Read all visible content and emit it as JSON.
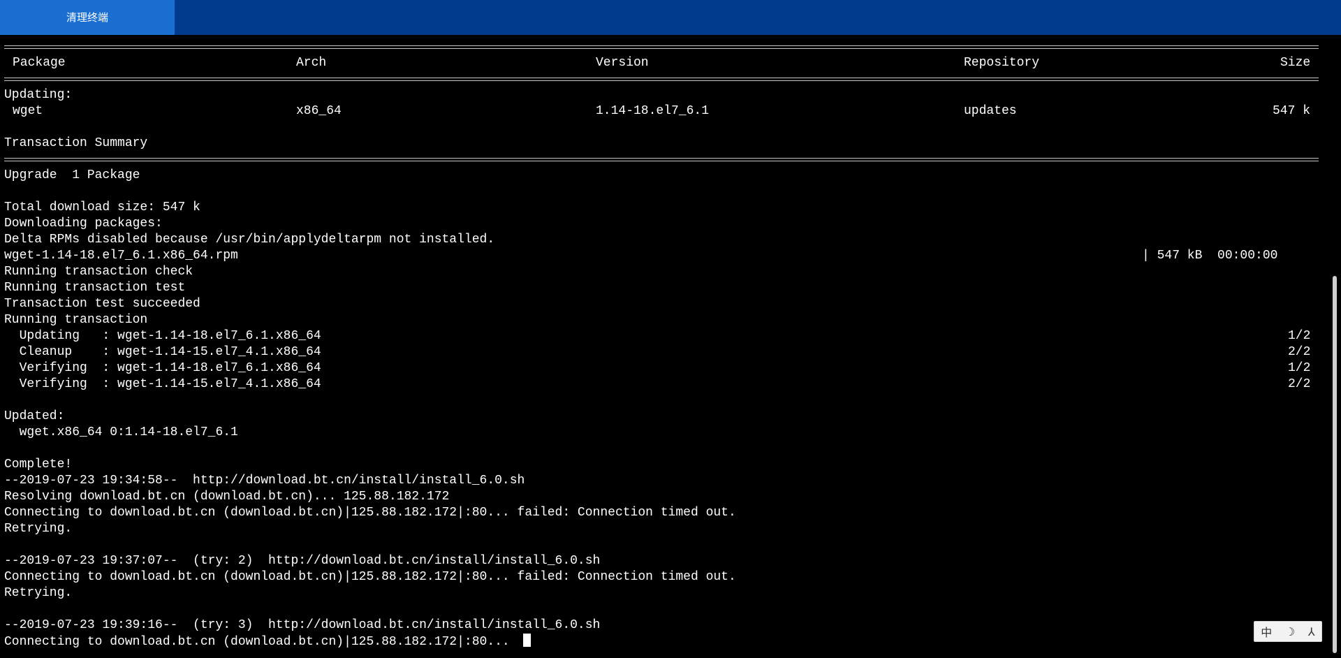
{
  "toolbar": {
    "clear_label": "清理终端"
  },
  "terminal": {
    "header": {
      "package": "Package",
      "arch": "Arch",
      "version": "Version",
      "repository": "Repository",
      "size": "Size"
    },
    "updating_label": "Updating:",
    "package_row": {
      "package": "wget",
      "arch": "x86_64",
      "version": "1.14-18.el7_6.1",
      "repository": "updates",
      "size": "547 k"
    },
    "summary_label": "Transaction Summary",
    "upgrade_line": "Upgrade  1 Package",
    "total_size_line": "Total download size: 547 k",
    "downloading_line": "Downloading packages:",
    "delta_line": "Delta RPMs disabled because /usr/bin/applydeltarpm not installed.",
    "rpm_file": "wget-1.14-18.el7_6.1.x86_64.rpm",
    "rpm_progress": "| 547 kB  00:00:00",
    "check_line": "Running transaction check",
    "test_line": "Running transaction test",
    "succeeded_line": "Transaction test succeeded",
    "running_line": "Running transaction",
    "steps": [
      {
        "text": "  Updating   : wget-1.14-18.el7_6.1.x86_64",
        "count": "1/2"
      },
      {
        "text": "  Cleanup    : wget-1.14-15.el7_4.1.x86_64",
        "count": "2/2"
      },
      {
        "text": "  Verifying  : wget-1.14-18.el7_6.1.x86_64",
        "count": "1/2"
      },
      {
        "text": "  Verifying  : wget-1.14-15.el7_4.1.x86_64",
        "count": "2/2"
      }
    ],
    "updated_label": "Updated:",
    "updated_pkg": "  wget.x86_64 0:1.14-18.el7_6.1",
    "complete_line": "Complete!",
    "log": [
      "--2019-07-23 19:34:58--  http://download.bt.cn/install/install_6.0.sh",
      "Resolving download.bt.cn (download.bt.cn)... 125.88.182.172",
      "Connecting to download.bt.cn (download.bt.cn)|125.88.182.172|:80... failed: Connection timed out.",
      "Retrying.",
      "--2019-07-23 19:37:07--  (try: 2)  http://download.bt.cn/install/install_6.0.sh",
      "Connecting to download.bt.cn (download.bt.cn)|125.88.182.172|:80... failed: Connection timed out.",
      "Retrying.",
      "--2019-07-23 19:39:16--  (try: 3)  http://download.bt.cn/install/install_6.0.sh",
      "Connecting to download.bt.cn (download.bt.cn)|125.88.182.172|:80... "
    ]
  },
  "ime": {
    "lang": "中",
    "moon": "☽",
    "mode": "⅄"
  }
}
